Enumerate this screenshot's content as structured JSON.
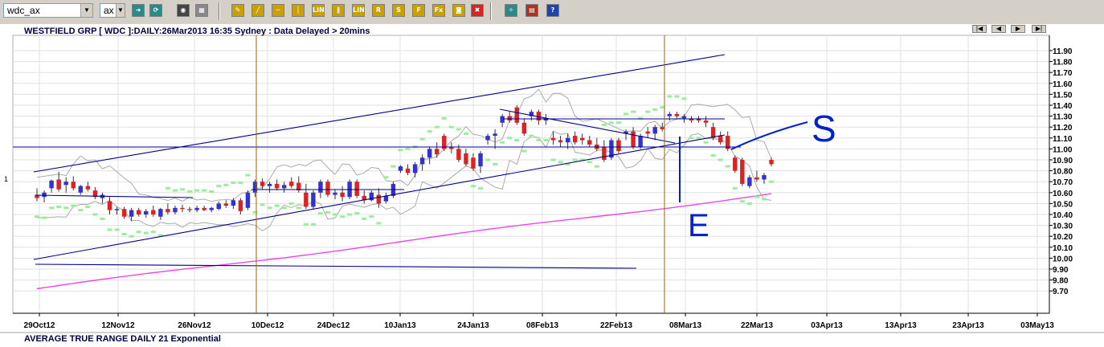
{
  "toolbar": {
    "symbol_value": "wdc_ax",
    "exchange_value": "ax",
    "buttons": [
      {
        "name": "go-icon",
        "glyph": "➜",
        "color": "#2a8a8a"
      },
      {
        "name": "refresh-icon",
        "glyph": "⟳",
        "color": "#2a8a8a"
      },
      {
        "name": "binoculars-icon",
        "glyph": "◉",
        "color": "#444444"
      },
      {
        "name": "print-icon",
        "glyph": "▦",
        "color": "#888888"
      },
      {
        "name": "pencil-icon",
        "glyph": "✎",
        "color": "#c8a000"
      },
      {
        "name": "line-tool-icon",
        "glyph": "╱",
        "color": "#c8a000"
      },
      {
        "name": "hline-tool-icon",
        "glyph": "─",
        "color": "#c8a000"
      },
      {
        "name": "vline-tool-icon",
        "glyph": "│",
        "color": "#c8a000"
      },
      {
        "name": "lin-tool-icon",
        "glyph": "LIN",
        "color": "#c8a000"
      },
      {
        "name": "parallel-tool-icon",
        "glyph": "∥",
        "color": "#c8a000"
      },
      {
        "name": "lin-channel-tool-icon",
        "glyph": "LIN",
        "color": "#c8a000"
      },
      {
        "name": "r-tool-icon",
        "glyph": "R",
        "color": "#c8a000"
      },
      {
        "name": "s-tool-icon",
        "glyph": "S",
        "color": "#c8a000"
      },
      {
        "name": "f-tool-icon",
        "glyph": "F",
        "color": "#c8a000"
      },
      {
        "name": "fx-tool-icon",
        "glyph": "Fx",
        "color": "#c8a000"
      },
      {
        "name": "camera-icon",
        "glyph": "◙",
        "color": "#c8a000"
      },
      {
        "name": "delete-icon",
        "glyph": "✖",
        "color": "#dd2222"
      },
      {
        "name": "settings-icon",
        "glyph": "✧",
        "color": "#2a8a8a"
      },
      {
        "name": "book-icon",
        "glyph": "▤",
        "color": "#aa3322"
      },
      {
        "name": "help-icon",
        "glyph": "?",
        "color": "#2244aa"
      }
    ]
  },
  "chart_data": {
    "type": "candlestick",
    "title": "WESTFIELD GRP [ WDC ]:DAILY:26Mar2013 16:35 Sydney : Data Delayed > 20mins",
    "left_axis_label": "1",
    "y_ticks": [
      "11.90",
      "11.80",
      "11.70",
      "11.60",
      "11.50",
      "11.40",
      "11.30",
      "11.20",
      "11.10",
      "11.00",
      "10.90",
      "10.80",
      "10.70",
      "10.60",
      "10.50",
      "10.40",
      "10.30",
      "10.20",
      "10.10",
      "10.00",
      "9.90",
      "9.80",
      "9.70"
    ],
    "ylim": [
      9.62,
      11.96
    ],
    "x_ticks": [
      "29Oct12",
      "12Nov12",
      "26Nov12",
      "10Dec12",
      "24Dec12",
      "10Jan13",
      "24Jan13",
      "08Feb13",
      "22Feb13",
      "08Mar13",
      "22Mar13",
      "03Apr13",
      "13Apr13",
      "23Apr13",
      "03May13"
    ],
    "colors": {
      "up": "#3333cc",
      "down": "#dd2222",
      "upper_band": "#aaaaaa",
      "psar": "#99ee99",
      "ma": "#ee44ee",
      "trendline": "#000088",
      "vline": "#996600",
      "annotation": "#0022cc",
      "grid": "#e0e0e0"
    },
    "candles": [
      {
        "o": 10.58,
        "h": 10.64,
        "l": 10.52,
        "c": 10.55
      },
      {
        "o": 10.56,
        "h": 10.62,
        "l": 10.51,
        "c": 10.6
      },
      {
        "o": 10.64,
        "h": 10.72,
        "l": 10.6,
        "c": 10.71
      },
      {
        "o": 10.72,
        "h": 10.79,
        "l": 10.61,
        "c": 10.63
      },
      {
        "o": 10.67,
        "h": 10.74,
        "l": 10.6,
        "c": 10.7
      },
      {
        "o": 10.7,
        "h": 10.75,
        "l": 10.62,
        "c": 10.64
      },
      {
        "o": 10.6,
        "h": 10.67,
        "l": 10.58,
        "c": 10.66
      },
      {
        "o": 10.66,
        "h": 10.7,
        "l": 10.61,
        "c": 10.63
      },
      {
        "o": 10.62,
        "h": 10.65,
        "l": 10.54,
        "c": 10.56
      },
      {
        "o": 10.55,
        "h": 10.6,
        "l": 10.5,
        "c": 10.58
      },
      {
        "o": 10.52,
        "h": 10.56,
        "l": 10.4,
        "c": 10.44
      },
      {
        "o": 10.44,
        "h": 10.47,
        "l": 10.4,
        "c": 10.45
      },
      {
        "o": 10.45,
        "h": 10.47,
        "l": 10.36,
        "c": 10.38
      },
      {
        "o": 10.38,
        "h": 10.46,
        "l": 10.34,
        "c": 10.44
      },
      {
        "o": 10.44,
        "h": 10.46,
        "l": 10.38,
        "c": 10.4
      },
      {
        "o": 10.4,
        "h": 10.45,
        "l": 10.37,
        "c": 10.43
      },
      {
        "o": 10.44,
        "h": 10.48,
        "l": 10.38,
        "c": 10.4
      },
      {
        "o": 10.38,
        "h": 10.46,
        "l": 10.35,
        "c": 10.45
      },
      {
        "o": 10.45,
        "h": 10.5,
        "l": 10.4,
        "c": 10.42
      },
      {
        "o": 10.42,
        "h": 10.48,
        "l": 10.4,
        "c": 10.46
      },
      {
        "o": 10.46,
        "h": 10.49,
        "l": 10.42,
        "c": 10.45
      },
      {
        "o": 10.45,
        "h": 10.47,
        "l": 10.42,
        "c": 10.44
      },
      {
        "o": 10.44,
        "h": 10.48,
        "l": 10.42,
        "c": 10.46
      },
      {
        "o": 10.46,
        "h": 10.48,
        "l": 10.43,
        "c": 10.44
      },
      {
        "o": 10.44,
        "h": 10.47,
        "l": 10.42,
        "c": 10.46
      },
      {
        "o": 10.45,
        "h": 10.52,
        "l": 10.44,
        "c": 10.5
      },
      {
        "o": 10.5,
        "h": 10.53,
        "l": 10.46,
        "c": 10.48
      },
      {
        "o": 10.48,
        "h": 10.55,
        "l": 10.45,
        "c": 10.53
      },
      {
        "o": 10.53,
        "h": 10.55,
        "l": 10.4,
        "c": 10.43
      },
      {
        "o": 10.46,
        "h": 10.62,
        "l": 10.44,
        "c": 10.6
      },
      {
        "o": 10.6,
        "h": 10.72,
        "l": 10.56,
        "c": 10.7
      },
      {
        "o": 10.7,
        "h": 10.73,
        "l": 10.63,
        "c": 10.66
      },
      {
        "o": 10.66,
        "h": 10.7,
        "l": 10.6,
        "c": 10.68
      },
      {
        "o": 10.68,
        "h": 10.72,
        "l": 10.62,
        "c": 10.64
      },
      {
        "o": 10.64,
        "h": 10.7,
        "l": 10.6,
        "c": 10.67
      },
      {
        "o": 10.7,
        "h": 10.74,
        "l": 10.64,
        "c": 10.66
      },
      {
        "o": 10.69,
        "h": 10.75,
        "l": 10.6,
        "c": 10.62
      },
      {
        "o": 10.6,
        "h": 10.68,
        "l": 10.45,
        "c": 10.47
      },
      {
        "o": 10.47,
        "h": 10.62,
        "l": 10.45,
        "c": 10.6
      },
      {
        "o": 10.6,
        "h": 10.72,
        "l": 10.55,
        "c": 10.7
      },
      {
        "o": 10.7,
        "h": 10.72,
        "l": 10.56,
        "c": 10.58
      },
      {
        "o": 10.58,
        "h": 10.63,
        "l": 10.54,
        "c": 10.6
      },
      {
        "o": 10.6,
        "h": 10.66,
        "l": 10.52,
        "c": 10.56
      },
      {
        "o": 10.56,
        "h": 10.72,
        "l": 10.54,
        "c": 10.7
      },
      {
        "o": 10.7,
        "h": 10.72,
        "l": 10.55,
        "c": 10.57
      },
      {
        "o": 10.57,
        "h": 10.62,
        "l": 10.5,
        "c": 10.53
      },
      {
        "o": 10.53,
        "h": 10.62,
        "l": 10.52,
        "c": 10.6
      },
      {
        "o": 10.58,
        "h": 10.64,
        "l": 10.46,
        "c": 10.5
      },
      {
        "o": 10.52,
        "h": 10.6,
        "l": 10.5,
        "c": 10.57
      },
      {
        "o": 10.57,
        "h": 10.7,
        "l": 10.55,
        "c": 10.68
      },
      {
        "o": 10.8,
        "h": 10.85,
        "l": 10.78,
        "c": 10.84
      },
      {
        "o": 10.82,
        "h": 10.86,
        "l": 10.76,
        "c": 10.78
      },
      {
        "o": 10.78,
        "h": 10.88,
        "l": 10.74,
        "c": 10.86
      },
      {
        "o": 10.86,
        "h": 10.95,
        "l": 10.8,
        "c": 10.92
      },
      {
        "o": 10.92,
        "h": 11.02,
        "l": 10.86,
        "c": 11.0
      },
      {
        "o": 11.0,
        "h": 11.06,
        "l": 10.92,
        "c": 10.95
      },
      {
        "o": 11.12,
        "h": 11.14,
        "l": 10.98,
        "c": 11.0
      },
      {
        "o": 11.02,
        "h": 11.06,
        "l": 10.96,
        "c": 11.0
      },
      {
        "o": 11.0,
        "h": 11.04,
        "l": 10.88,
        "c": 10.9
      },
      {
        "o": 10.96,
        "h": 11.0,
        "l": 10.84,
        "c": 10.86
      },
      {
        "o": 10.92,
        "h": 10.96,
        "l": 10.8,
        "c": 10.82
      },
      {
        "o": 10.84,
        "h": 10.98,
        "l": 10.78,
        "c": 10.96
      },
      {
        "o": 11.08,
        "h": 11.14,
        "l": 11.04,
        "c": 11.12
      },
      {
        "o": 11.12,
        "h": 11.18,
        "l": 11.0,
        "c": 11.14
      },
      {
        "o": 11.24,
        "h": 11.32,
        "l": 11.2,
        "c": 11.3
      },
      {
        "o": 11.3,
        "h": 11.34,
        "l": 11.24,
        "c": 11.26
      },
      {
        "o": 11.38,
        "h": 11.4,
        "l": 11.22,
        "c": 11.24
      },
      {
        "o": 11.24,
        "h": 11.28,
        "l": 11.12,
        "c": 11.14
      },
      {
        "o": 11.3,
        "h": 11.36,
        "l": 11.26,
        "c": 11.34
      },
      {
        "o": 11.34,
        "h": 11.36,
        "l": 11.22,
        "c": 11.26
      },
      {
        "o": 11.26,
        "h": 11.32,
        "l": 11.22,
        "c": 11.28
      },
      {
        "o": 11.1,
        "h": 11.16,
        "l": 11.04,
        "c": 11.08
      },
      {
        "o": 11.08,
        "h": 11.12,
        "l": 11.02,
        "c": 11.06
      },
      {
        "o": 11.06,
        "h": 11.14,
        "l": 11.0,
        "c": 11.1
      },
      {
        "o": 11.12,
        "h": 11.16,
        "l": 11.04,
        "c": 11.06
      },
      {
        "o": 11.1,
        "h": 11.14,
        "l": 11.04,
        "c": 11.08
      },
      {
        "o": 11.08,
        "h": 11.12,
        "l": 11.02,
        "c": 11.04
      },
      {
        "o": 11.04,
        "h": 11.1,
        "l": 10.98,
        "c": 11.0
      },
      {
        "o": 11.02,
        "h": 11.08,
        "l": 10.88,
        "c": 10.9
      },
      {
        "o": 10.92,
        "h": 11.1,
        "l": 10.9,
        "c": 11.08
      },
      {
        "o": 11.08,
        "h": 11.1,
        "l": 10.96,
        "c": 10.98
      },
      {
        "o": 11.14,
        "h": 11.18,
        "l": 11.08,
        "c": 11.16
      },
      {
        "o": 11.16,
        "h": 11.2,
        "l": 11.0,
        "c": 11.02
      },
      {
        "o": 11.02,
        "h": 11.14,
        "l": 11.0,
        "c": 11.12
      },
      {
        "o": 11.16,
        "h": 11.2,
        "l": 11.1,
        "c": 11.14
      },
      {
        "o": 11.14,
        "h": 11.22,
        "l": 11.08,
        "c": 11.2
      },
      {
        "o": 11.2,
        "h": 11.24,
        "l": 11.16,
        "c": 11.18
      },
      {
        "o": 11.3,
        "h": 11.34,
        "l": 11.26,
        "c": 11.32
      },
      {
        "o": 11.32,
        "h": 11.34,
        "l": 11.28,
        "c": 11.3
      },
      {
        "o": 11.28,
        "h": 11.32,
        "l": 11.24,
        "c": 11.3
      },
      {
        "o": 11.28,
        "h": 11.3,
        "l": 11.24,
        "c": 11.26
      },
      {
        "o": 11.28,
        "h": 11.3,
        "l": 11.24,
        "c": 11.26
      },
      {
        "o": 11.26,
        "h": 11.3,
        "l": 11.2,
        "c": 11.24
      },
      {
        "o": 11.2,
        "h": 11.24,
        "l": 11.08,
        "c": 11.1
      },
      {
        "o": 11.12,
        "h": 11.16,
        "l": 11.04,
        "c": 11.06
      },
      {
        "o": 11.12,
        "h": 11.16,
        "l": 10.98,
        "c": 11.0
      },
      {
        "o": 10.92,
        "h": 10.94,
        "l": 10.78,
        "c": 10.8
      },
      {
        "o": 10.9,
        "h": 10.92,
        "l": 10.66,
        "c": 10.68
      },
      {
        "o": 10.66,
        "h": 10.76,
        "l": 10.64,
        "c": 10.74
      },
      {
        "o": 10.74,
        "h": 10.8,
        "l": 10.7,
        "c": 10.72
      },
      {
        "o": 10.72,
        "h": 10.78,
        "l": 10.68,
        "c": 10.76
      },
      {
        "o": 10.9,
        "h": 10.92,
        "l": 10.84,
        "c": 10.86
      }
    ],
    "atr_label": "AVERAGE TRUE RANGE DAILY 21 Exponential",
    "annotations": [
      "S",
      "E"
    ]
  },
  "nav": [
    {
      "name": "first-page-button",
      "glyph": "|◀"
    },
    {
      "name": "prev-button",
      "glyph": "◀"
    },
    {
      "name": "next-button",
      "glyph": "▶"
    },
    {
      "name": "last-page-button",
      "glyph": "▶|"
    }
  ]
}
